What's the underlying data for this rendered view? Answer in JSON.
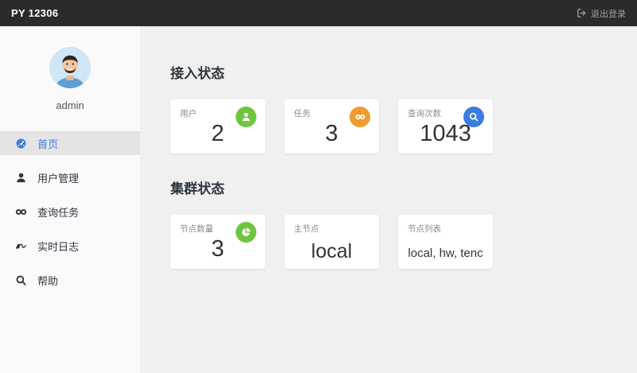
{
  "header": {
    "brand": "PY 12306",
    "logout_label": "退出登录"
  },
  "sidebar": {
    "username": "admin",
    "items": [
      {
        "label": "首页",
        "icon": "dashboard-icon",
        "active": true
      },
      {
        "label": "用户管理",
        "icon": "user-icon",
        "active": false
      },
      {
        "label": "查询任务",
        "icon": "infinity-icon",
        "active": false
      },
      {
        "label": "实时日志",
        "icon": "signature-icon",
        "active": false
      },
      {
        "label": "帮助",
        "icon": "search-icon",
        "active": false
      }
    ]
  },
  "main": {
    "sections": [
      {
        "title": "接入状态",
        "cards": [
          {
            "label": "用户",
            "value": "2",
            "icon": "user-icon",
            "icon_color": "#6fc53e"
          },
          {
            "label": "任务",
            "value": "3",
            "icon": "infinity-icon",
            "icon_color": "#f09b2f"
          },
          {
            "label": "查询次数",
            "value": "1043",
            "icon": "search-icon",
            "icon_color": "#3b7ce2"
          }
        ]
      },
      {
        "title": "集群状态",
        "cards": [
          {
            "label": "节点数量",
            "value": "3",
            "icon": "pie-chart-icon",
            "icon_color": "#6fc53e"
          },
          {
            "label": "主节点",
            "value": "local"
          },
          {
            "label": "节点列表",
            "value": "local, hw, tenc"
          }
        ]
      }
    ]
  },
  "colors": {
    "topbar_bg": "#2b2b2b",
    "sidebar_bg": "#fafafa",
    "main_bg": "#f0f0f0",
    "active_item_bg": "#e4e4e4",
    "accent_blue": "#3a7be2",
    "stat_green": "#6fc53e",
    "stat_orange": "#f09b2f",
    "stat_blue": "#3b7ce2"
  }
}
